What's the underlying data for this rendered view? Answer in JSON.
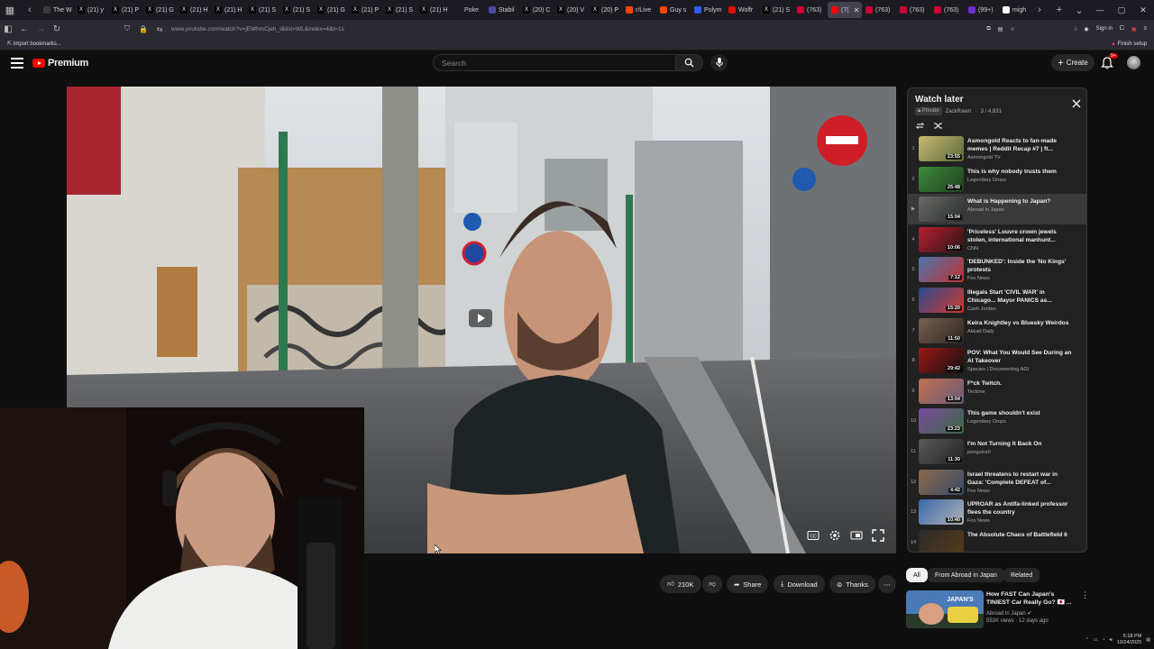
{
  "browser": {
    "tabs": [
      {
        "label": "The W",
        "icon": "page-icon",
        "color": "#3a3a3a"
      },
      {
        "label": "(21) y",
        "icon": "x-logo-icon",
        "color": "#000000"
      },
      {
        "label": "(21) P",
        "icon": "x-logo-icon",
        "color": "#000000"
      },
      {
        "label": "(21) G",
        "icon": "x-logo-icon",
        "color": "#000000"
      },
      {
        "label": "(21) H",
        "icon": "x-logo-icon",
        "color": "#000000"
      },
      {
        "label": "(21) H",
        "icon": "x-logo-icon",
        "color": "#000000"
      },
      {
        "label": "(21) S",
        "icon": "x-logo-icon",
        "color": "#000000"
      },
      {
        "label": "(21) S",
        "icon": "x-logo-icon",
        "color": "#000000"
      },
      {
        "label": "(21) G",
        "icon": "x-logo-icon",
        "color": "#000000"
      },
      {
        "label": "(21) P",
        "icon": "x-logo-icon",
        "color": "#000000"
      },
      {
        "label": "(21) S",
        "icon": "x-logo-icon",
        "color": "#000000"
      },
      {
        "label": "(21) H",
        "icon": "x-logo-icon",
        "color": "#000000"
      },
      {
        "label": "Poke",
        "icon": "pokeball-icon",
        "color": "#1c1b22"
      },
      {
        "label": "Stabil",
        "icon": "globe-icon",
        "color": "#4a4aa0"
      },
      {
        "label": "(20) C",
        "icon": "x-logo-icon",
        "color": "#000000"
      },
      {
        "label": "(20) V",
        "icon": "x-logo-icon",
        "color": "#000000"
      },
      {
        "label": "(20) P",
        "icon": "x-logo-icon",
        "color": "#000000"
      },
      {
        "label": "r/Live",
        "icon": "reddit-icon",
        "color": "#ff4500"
      },
      {
        "label": "Guy s",
        "icon": "reddit-icon",
        "color": "#ff4500"
      },
      {
        "label": "Polym",
        "icon": "polymarket-icon",
        "color": "#2e5cff"
      },
      {
        "label": "Wolfr",
        "icon": "wolfram-icon",
        "color": "#dd1100"
      },
      {
        "label": "(21) S",
        "icon": "x-logo-icon",
        "color": "#000000"
      },
      {
        "label": "(763)",
        "icon": "twitch-icon",
        "color": "#cc0033"
      },
      {
        "label": "(7(",
        "icon": "youtube-icon",
        "color": "#ff0000",
        "active": true
      },
      {
        "label": "(763)",
        "icon": "twitch-icon",
        "color": "#cc0033"
      },
      {
        "label": "(763)",
        "icon": "twitch-icon",
        "color": "#cc0033"
      },
      {
        "label": "(763)",
        "icon": "twitch-icon",
        "color": "#cc0033"
      },
      {
        "label": "(99+)",
        "icon": "mail-icon",
        "color": "#6b2fd1"
      },
      {
        "label": "migh",
        "icon": "google-icon",
        "color": "#ffffff"
      }
    ],
    "url": "www.youtube.com/watch?v=jEWhmCjeh_I&list=WL&index=4&t=1s",
    "sign_in": "Sign in",
    "import_bookmarks": "Import bookmarks...",
    "finish_setup": "Finish setup"
  },
  "youtube": {
    "logo_text": "Premium",
    "search_placeholder": "Search",
    "create_label": "Create",
    "notif_badge": "9+",
    "accent": "#ff0000"
  },
  "actions": {
    "likes": "210K",
    "share": "Share",
    "download": "Download",
    "thanks": "Thanks"
  },
  "playlist": {
    "title": "Watch later",
    "privacy": "Private",
    "owner": "ZackRawrr",
    "position": "3 / 4,831",
    "items": [
      {
        "index": "1",
        "title": "Asmongold Reacts to fan-made memes | Reddit Recap #7 | ft...",
        "channel": "Asmongold TV",
        "duration": "23:55",
        "thumb": [
          "#c8b870",
          "#5a6a3a"
        ]
      },
      {
        "index": "2",
        "title": "This is why nobody trusts them",
        "channel": "Legendary Drops",
        "duration": "25:48",
        "thumb": [
          "#3c8a3a",
          "#204020"
        ]
      },
      {
        "index": "▶",
        "title": "What is Happening to Japan?",
        "channel": "Abroad in Japan",
        "duration": "15:04",
        "thumb": [
          "#6a6a66",
          "#2a2e30"
        ],
        "active": true
      },
      {
        "index": "4",
        "title": "'Priceless' Louvre crown jewels stolen, international manhunt...",
        "channel": "CNN",
        "duration": "10:06",
        "thumb": [
          "#b82030",
          "#2a1416"
        ]
      },
      {
        "index": "5",
        "title": "'DEBUNKED': Inside the 'No Kings' protests",
        "channel": "Fox News",
        "duration": "7:12",
        "thumb": [
          "#4a78b0",
          "#c03030"
        ]
      },
      {
        "index": "6",
        "title": "Illegals Start 'CIVIL WAR' in Chicago... Mayor PANICS as...",
        "channel": "Cash Jordan",
        "duration": "15:20",
        "thumb": [
          "#2a4a90",
          "#d03a2a"
        ]
      },
      {
        "index": "7",
        "title": "Keira Knightley vs Bluesky Weirdos",
        "channel": "Akkad Daily",
        "duration": "11:50",
        "thumb": [
          "#7a6050",
          "#2a2622"
        ]
      },
      {
        "index": "8",
        "title": "POV: What You Would See During an AI Takeover",
        "channel": "Species | Documenting AGI",
        "duration": "29:42",
        "thumb": [
          "#a01818",
          "#101010"
        ]
      },
      {
        "index": "9",
        "title": "F*ck Twitch.",
        "channel": "Tectone",
        "duration": "13:04",
        "thumb": [
          "#c07050",
          "#6a5a78"
        ]
      },
      {
        "index": "10",
        "title": "This game shouldn't exist",
        "channel": "Legendary Drops",
        "duration": "23:23",
        "thumb": [
          "#7a4aa0",
          "#3a6a40"
        ]
      },
      {
        "index": "11",
        "title": "I'm Not Turning It Back On",
        "channel": "penguinz0",
        "duration": "11:30",
        "thumb": [
          "#5a5a5a",
          "#222222"
        ]
      },
      {
        "index": "12",
        "title": "Israel threatens to restart war in Gaza: 'Complete DEFEAT of...",
        "channel": "Fox News",
        "duration": "4:42",
        "thumb": [
          "#8a6a4a",
          "#3a4a6a"
        ]
      },
      {
        "index": "13",
        "title": "UPROAR as Antifa-linked professor flees the country",
        "channel": "Fox News",
        "duration": "10:40",
        "thumb": [
          "#3a6ab0",
          "#b0b0b0"
        ]
      },
      {
        "index": "14",
        "title": "The Absolute Chaos of Battlefield 6",
        "channel": "",
        "duration": "",
        "thumb": [
          "#2a2a2a",
          "#5a3a1a"
        ]
      }
    ]
  },
  "chips": [
    {
      "label": "All",
      "selected": true
    },
    {
      "label": "From Abroad in Japan",
      "selected": false
    },
    {
      "label": "Related",
      "selected": false
    }
  ],
  "recommendation": {
    "title": "How FAST Can Japan's TINIEST Car Really Go? 🇯🇵 ...",
    "channel": "Abroad in Japan",
    "meta": "551K views · 12 days ago",
    "thumb_text": "JAPAN'S"
  },
  "taskbar": {
    "time": "5:18 PM",
    "date": "10/24/2025"
  }
}
